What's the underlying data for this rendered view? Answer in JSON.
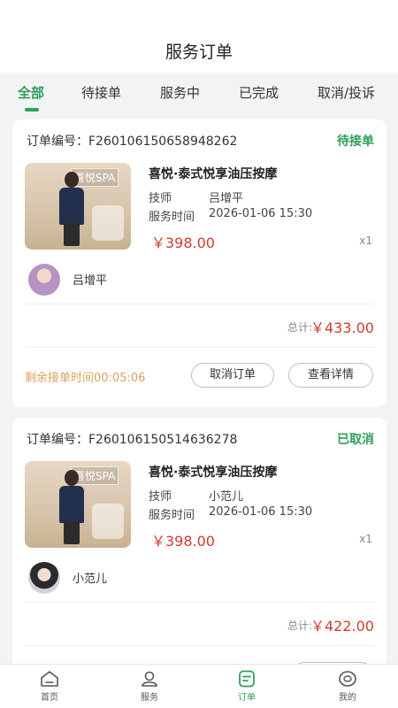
{
  "header": {
    "title": "服务订单"
  },
  "tabs": [
    {
      "label": "全部",
      "active": true
    },
    {
      "label": "待接单",
      "active": false
    },
    {
      "label": "服务中",
      "active": false
    },
    {
      "label": "已完成",
      "active": false
    },
    {
      "label": "取消/投诉",
      "active": false
    }
  ],
  "orders": [
    {
      "order_label": "订单编号：",
      "order_no": "F260106150658948262",
      "status": "待接单",
      "service_title": "喜悦·泰式悦享油压按摩",
      "thumb_brand": "喜悦SPA",
      "tech_label": "技师",
      "tech_value": "吕增平",
      "time_label": "服务时间",
      "time_value": "2026-01-06 15:30",
      "price": "￥398.00",
      "qty": "x1",
      "tech_name": "吕增平",
      "total_label": "总计:",
      "total": "￥433.00",
      "countdown": "剩余接单时间00:05:06",
      "cancel_btn": "取消订单",
      "detail_btn": "查看详情"
    },
    {
      "order_label": "订单编号：",
      "order_no": "F260106150514636278",
      "status": "已取消",
      "service_title": "喜悦·泰式悦享油压按摩",
      "thumb_brand": "喜悦SPA",
      "tech_label": "技师",
      "tech_value": "小范儿",
      "time_label": "服务时间",
      "time_value": "2026-01-06 15:30",
      "price": "￥398.00",
      "qty": "x1",
      "tech_name": "小范儿",
      "total_label": "总计:",
      "total": "￥422.00"
    }
  ],
  "tabbar": [
    {
      "label": "首页",
      "icon": "home-icon",
      "active": false
    },
    {
      "label": "服务",
      "icon": "service-icon",
      "active": false
    },
    {
      "label": "订单",
      "icon": "order-icon",
      "active": true
    },
    {
      "label": "我的",
      "icon": "profile-icon",
      "active": false
    }
  ],
  "colors": {
    "accent": "#2f9e5b",
    "price": "#d23b2f",
    "countdown": "#d8a35f"
  }
}
